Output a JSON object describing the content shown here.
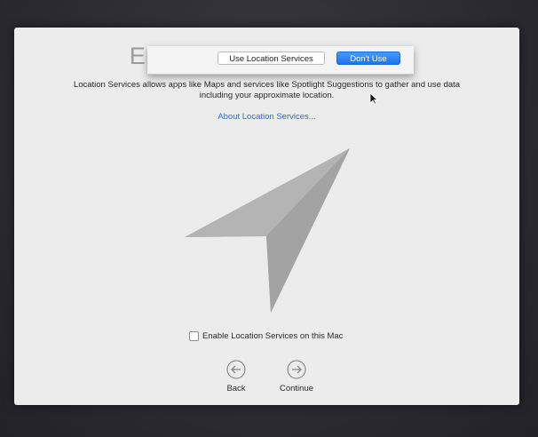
{
  "alert": {
    "use_label": "Use Location Services",
    "dont_use_label": "Don't Use"
  },
  "page": {
    "title": "Enable Location Services",
    "description": "Location Services allows apps like Maps and services like Spotlight Suggestions to gather and use data including your approximate location.",
    "about_link": "About Location Services..."
  },
  "illustration": {
    "icon": "location-arrow-icon"
  },
  "options": {
    "enable_label": "Enable Location Services on this Mac",
    "enable_checked": false
  },
  "navigation": {
    "back_label": "Back",
    "continue_label": "Continue"
  },
  "colors": {
    "link": "#2f6fc9",
    "primary_button": "#1c75ef",
    "window_background": "#ececec"
  }
}
